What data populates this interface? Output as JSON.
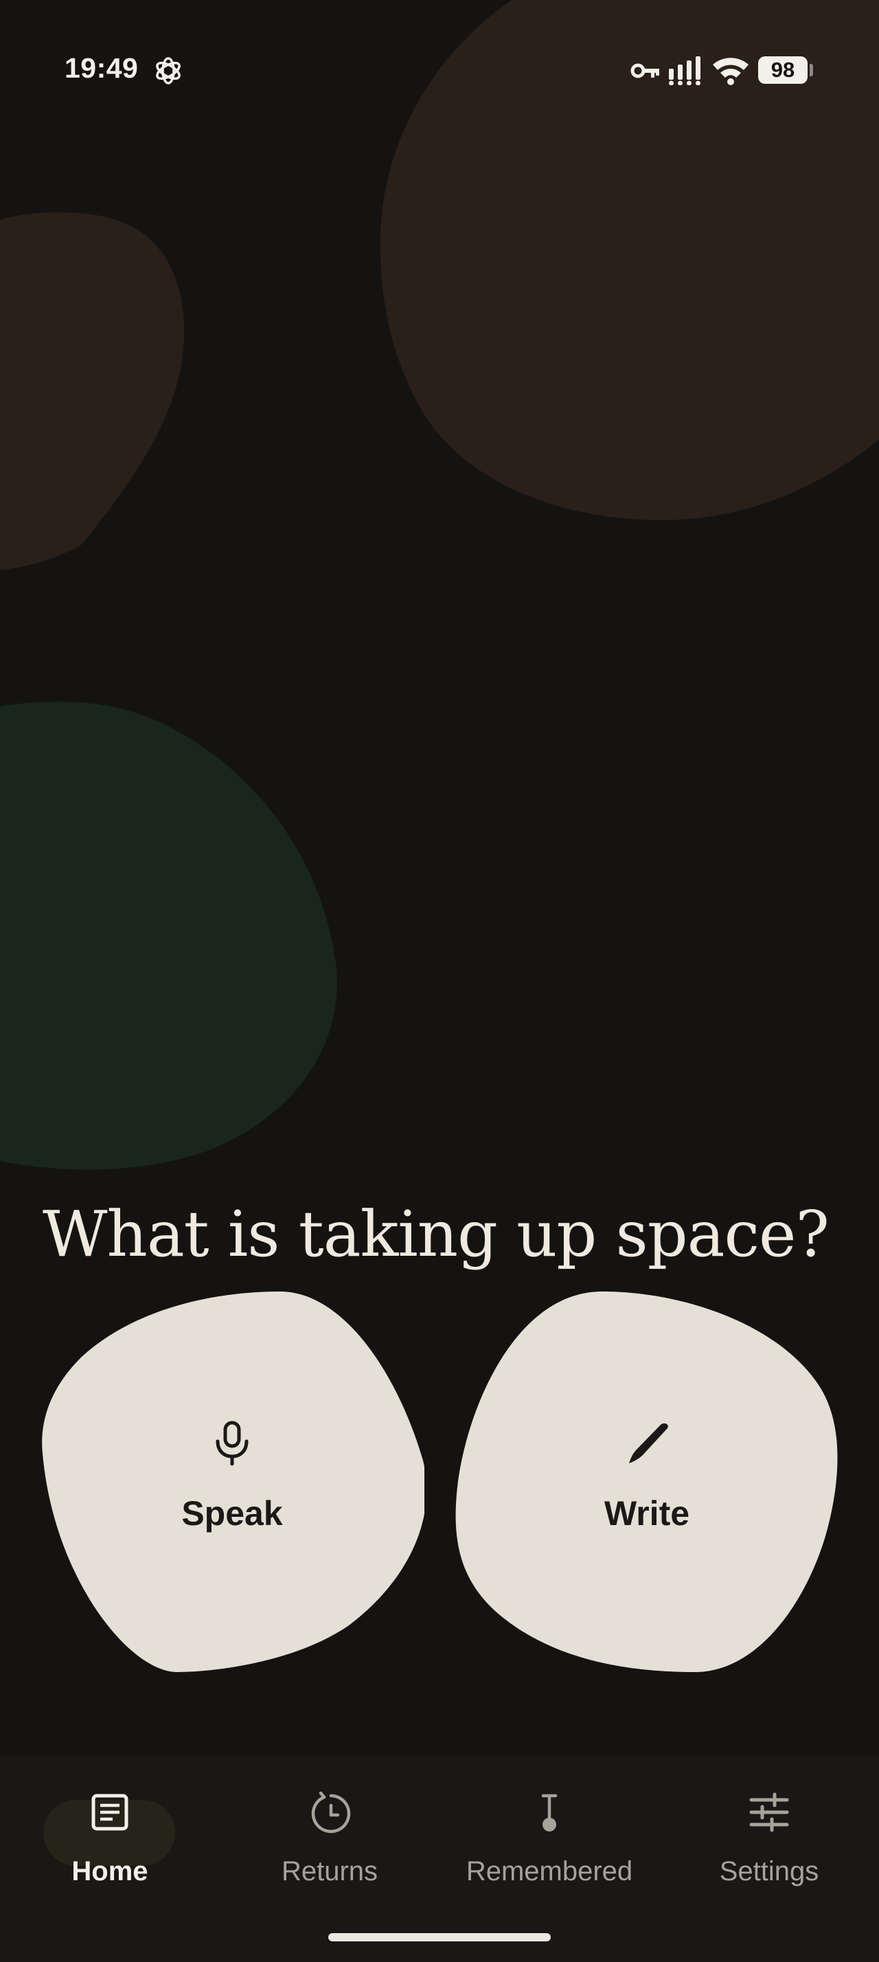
{
  "status_bar": {
    "time": "19:49",
    "battery": "98",
    "icons": [
      "openai-icon",
      "vpn-key-icon",
      "signal-icon",
      "wifi-icon",
      "battery-icon"
    ]
  },
  "main": {
    "headline": "What is taking up space?",
    "actions": [
      {
        "label": "Speak",
        "icon": "microphone-icon"
      },
      {
        "label": "Write",
        "icon": "pen-icon"
      }
    ]
  },
  "bottom_nav": {
    "items": [
      {
        "label": "Home",
        "icon": "journal-icon",
        "active": true
      },
      {
        "label": "Returns",
        "icon": "history-clock-icon",
        "active": false
      },
      {
        "label": "Remembered",
        "icon": "pin-icon",
        "active": false
      },
      {
        "label": "Settings",
        "icon": "sliders-icon",
        "active": false
      }
    ]
  },
  "colors": {
    "background": "#141312",
    "blob_brown": "#2a1f19",
    "blob_green": "#19261c",
    "action_fill": "#e5e0d6",
    "text_light": "#efe9df",
    "nav_background": "#191816"
  }
}
